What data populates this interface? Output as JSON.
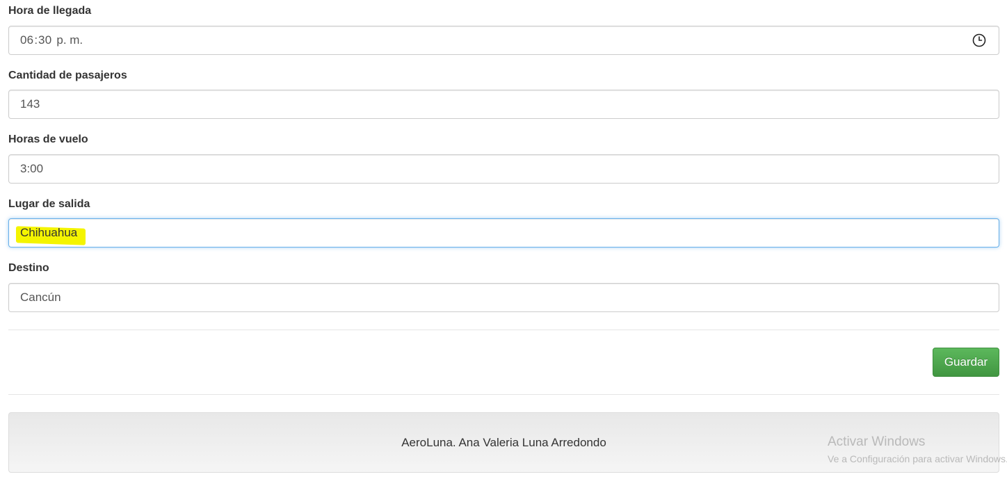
{
  "form": {
    "arrival_time": {
      "label": "Hora de llegada",
      "hour": "06",
      "sep": ":",
      "minute": "30",
      "ampm": "p. m."
    },
    "passengers": {
      "label": "Cantidad de pasajeros",
      "value": "143"
    },
    "flight_hours": {
      "label": "Horas de vuelo",
      "value": "3:00"
    },
    "departure": {
      "label": "Lugar de salida",
      "value": "Chihuahua"
    },
    "destination": {
      "label": "Destino",
      "value": "Cancún"
    },
    "save_label": "Guardar"
  },
  "footer": {
    "text": "AeroLuna. Ana Valeria Luna Arredondo"
  },
  "watermark": {
    "title": "Activar Windows",
    "subtitle": "Ve a Configuración para activar Windows."
  },
  "colors": {
    "save_button": "#5cb85c",
    "highlight": "#f4f400",
    "focus_border": "#66afe9"
  },
  "icons": {
    "time_picker": "clock-icon"
  }
}
